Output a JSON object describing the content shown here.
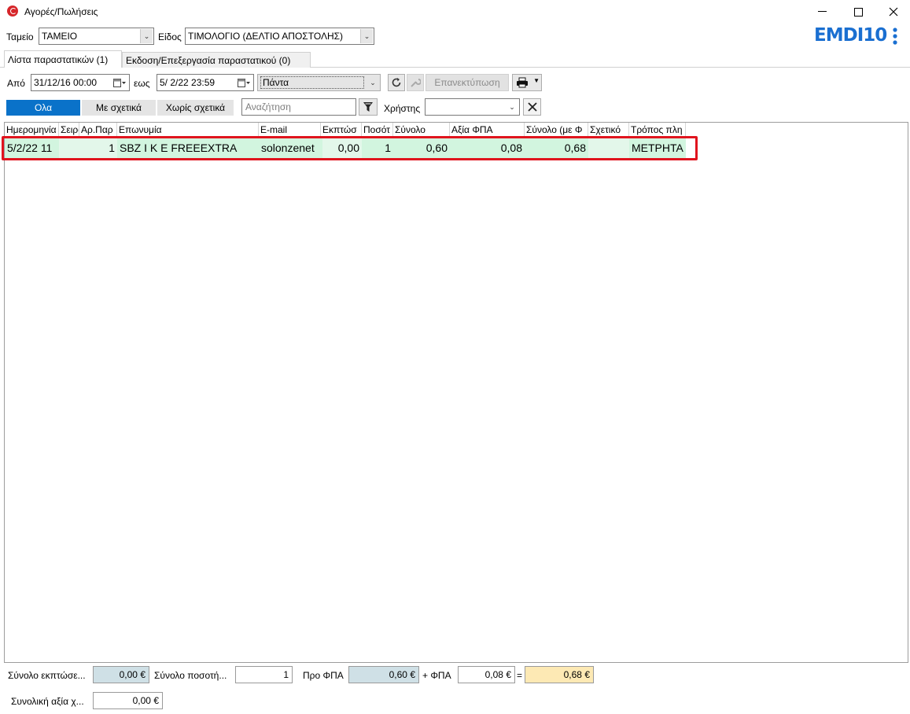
{
  "window": {
    "title": "Αγορές/Πωλήσεις"
  },
  "toolbar": {
    "cash_label": "Ταμείο",
    "cash_value": "ΤΑΜΕΙΟ",
    "type_label": "Είδος",
    "type_value": "ΤΙΜΟΛΟΓΙΟ (ΔΕΛΤΙΟ ΑΠΟΣΤΟΛΗΣ)",
    "logo_text": "EMDI10"
  },
  "tabs": [
    {
      "label": "Λίστα παραστατικών (1)",
      "active": true
    },
    {
      "label": "Εκδοση/Επεξεργασία παραστατικού (0)",
      "active": false
    }
  ],
  "filters": {
    "from_label": "Από",
    "from_value": "31/12/16 00:00",
    "to_label": "εως",
    "to_value": "5/  2/22 23:59",
    "period_value": "Πάντα",
    "reprint_label": "Επανεκτύπωση",
    "seg_all": "Ολα",
    "seg_related": "Με σχετικά",
    "seg_unrelated": "Χωρίς σχετικά",
    "search_placeholder": "Αναζήτηση",
    "user_label": "Χρήστης",
    "user_value": ""
  },
  "grid": {
    "headers": [
      "Ημερομηνία",
      "Σειρά",
      "Αρ.Παρ",
      "Επωνυμία",
      "E-mail",
      "Εκπτώσ",
      "Ποσότ",
      "Σύνολο",
      "Αξία ΦΠΑ",
      "Σύνολο (με Φ",
      "Σχετικό",
      "Τρόπος πλη"
    ],
    "rows": [
      {
        "date": "5/2/22 11",
        "series": "",
        "number": "1",
        "name": "SBZ I K E  FREEEXTRA",
        "email": "solonzenet",
        "discount": "0,00",
        "quantity": "1",
        "total": "0,60",
        "vat": "0,08",
        "total_vat": "0,68",
        "related": "",
        "payment": "ΜΕΤΡΗΤΑ"
      }
    ]
  },
  "totals": {
    "discount_label": "Σύνολο εκπτώσε...",
    "discount_value": "0,00 €",
    "quantity_label": "Σύνολο ποσοτή...",
    "quantity_value": "1",
    "net_label": "Προ ΦΠΑ",
    "net_value": "0,60 €",
    "vat_label": "+ ΦΠΑ",
    "vat_value": "0,08 €",
    "equals": "=",
    "grand_value": "0,68 €",
    "total_value_label": "Συνολική αξία χ...",
    "total_value": "0,00 €"
  },
  "colors": {
    "accent": "#0a72c9",
    "row_bg": "#d2f5df",
    "highlight": "#e0141e",
    "logo_blue": "#1a6fd1"
  }
}
